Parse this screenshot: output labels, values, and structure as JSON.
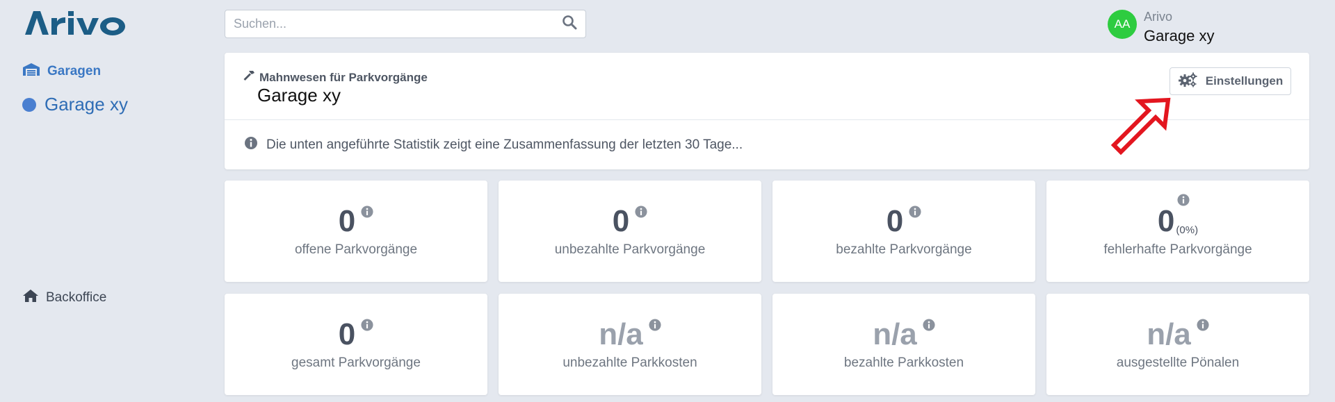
{
  "app": {
    "logo_text": "ArIVO"
  },
  "sidebar": {
    "items": [
      {
        "label": "Garagen"
      },
      {
        "label": "Garage xy"
      },
      {
        "label": "Backoffice"
      }
    ]
  },
  "header": {
    "search_placeholder": "Suchen...",
    "user": {
      "initials": "AA",
      "name": "Arivo",
      "garage": "Garage xy"
    }
  },
  "main": {
    "subtitle": "Mahnwesen für Parkvorgänge",
    "title": "Garage xy",
    "settings_label": "Einstellungen",
    "info_text": "Die unten angeführte Statistik zeigt eine Zusammenfassung der letzten 30 Tage..."
  },
  "stats": [
    {
      "value": "0",
      "label": "offene Parkvorgänge"
    },
    {
      "value": "0",
      "label": "unbezahlte Parkvorgänge"
    },
    {
      "value": "0",
      "label": "bezahlte Parkvorgänge"
    },
    {
      "value": "0",
      "percent": "(0%)",
      "label": "fehlerhafte Parkvorgänge"
    },
    {
      "value": "0",
      "label": "gesamt Parkvorgänge"
    },
    {
      "value": "n/a",
      "label": "unbezahlte Parkkosten"
    },
    {
      "value": "n/a",
      "label": "bezahlte Parkkosten"
    },
    {
      "value": "n/a",
      "label": "ausgestellte Pönalen"
    }
  ],
  "colors": {
    "background": "#e4e8ef",
    "brand": "#1c5d86",
    "nav_active": "#3b78c4",
    "avatar": "#2ecc40",
    "annotation_arrow": "#e3161f"
  },
  "icons": {
    "garage": "garage-icon",
    "dot": "dot-icon",
    "home": "home-icon",
    "search": "search-icon",
    "hammer": "hammer-icon",
    "gears": "gears-icon",
    "info": "info-icon"
  }
}
